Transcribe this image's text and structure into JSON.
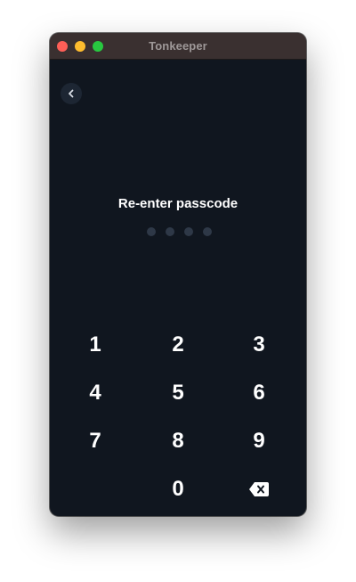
{
  "window": {
    "title": "Tonkeeper"
  },
  "screen": {
    "heading": "Re-enter passcode",
    "passcode_length": 4,
    "entered_digits": 0
  },
  "keypad": {
    "keys": [
      "1",
      "2",
      "3",
      "4",
      "5",
      "6",
      "7",
      "8",
      "9",
      "0"
    ],
    "icons": {
      "back": "chevron-left-icon",
      "delete": "backspace-icon"
    }
  },
  "colors": {
    "background": "#10161f",
    "titlebar": "#3a3030",
    "dot_empty": "#2e3847",
    "text": "#ffffff"
  }
}
